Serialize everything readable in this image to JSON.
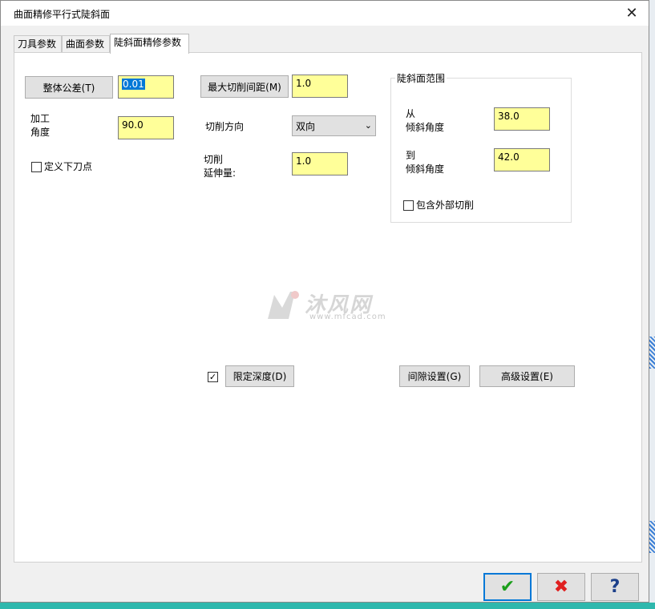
{
  "dialog": {
    "title": "曲面精修平行式陡斜面",
    "close_glyph": "✕"
  },
  "tabs": [
    "刀具参数",
    "曲面参数",
    "陡斜面精修参数"
  ],
  "tab_active_index": 2,
  "left": {
    "tolerance_button": "整体公差(T)",
    "tolerance_value": "0.01",
    "angle_label_line1": "加工",
    "angle_label_line2": "角度",
    "angle_value": "90.0",
    "entry_point_label": "定义下刀点",
    "entry_point_checked": false
  },
  "middle": {
    "max_stepover_button": "最大切削间距(M)",
    "max_stepover_value": "1.0",
    "cut_direction_label": "切削方向",
    "cut_direction_value": "双向",
    "cut_extension_label_line1": "切削",
    "cut_extension_label_line2": "延伸量:",
    "cut_extension_value": "1.0"
  },
  "steep_range": {
    "group_title": "陡斜面范围",
    "from_label_line1": "从",
    "from_label_line2": "倾斜角度",
    "from_value": "38.0",
    "to_label_line1": "到",
    "to_label_line2": "倾斜角度",
    "to_value": "42.0",
    "include_outer_label": "包含外部切削",
    "include_outer_checked": false
  },
  "bottom_row": {
    "limit_depth_checked": true,
    "limit_depth_button": "限定深度(D)",
    "gap_settings_button": "间隙设置(G)",
    "advanced_settings_button": "高级设置(E)"
  },
  "watermark": {
    "text": "沐风网",
    "sub": "www.mfcad.com"
  },
  "footer": {
    "ok_glyph": "✔",
    "cancel_glyph": "✖",
    "help_glyph": "?"
  },
  "colors": {
    "field_bg": "#ffff99",
    "selection": "#0078d7",
    "ok_green": "#1a9e1a",
    "cancel_red": "#e02020",
    "help_blue": "#1b3f8a"
  }
}
